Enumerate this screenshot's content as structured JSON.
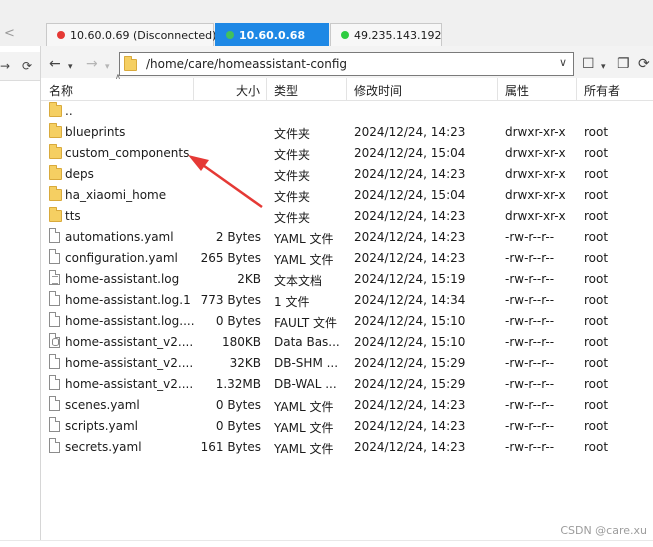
{
  "tabs": [
    {
      "label": "10.60.0.69 (Disconnected)",
      "dot_color": "#e53935",
      "active": false
    },
    {
      "label": "10.60.0.68",
      "dot_color": "#43c15b",
      "active": true
    },
    {
      "label": "49.235.143.192",
      "dot_color": "#2ecc40",
      "active": false
    }
  ],
  "toolbar": {
    "path": "/home/care/homeassistant-config"
  },
  "columns": {
    "name": "名称",
    "size": "大小",
    "type": "类型",
    "modified": "修改时间",
    "attributes": "属性",
    "owner": "所有者"
  },
  "files": [
    {
      "name": "..",
      "size": "",
      "type": "",
      "modified": "",
      "perm": "",
      "owner": "",
      "kind": "folder"
    },
    {
      "name": "blueprints",
      "size": "",
      "type": "文件夹",
      "modified": "2024/12/24, 14:23",
      "perm": "drwxr-xr-x",
      "owner": "root",
      "kind": "folder"
    },
    {
      "name": "custom_components",
      "size": "",
      "type": "文件夹",
      "modified": "2024/12/24, 15:04",
      "perm": "drwxr-xr-x",
      "owner": "root",
      "kind": "folder"
    },
    {
      "name": "deps",
      "size": "",
      "type": "文件夹",
      "modified": "2024/12/24, 14:23",
      "perm": "drwxr-xr-x",
      "owner": "root",
      "kind": "folder"
    },
    {
      "name": "ha_xiaomi_home",
      "size": "",
      "type": "文件夹",
      "modified": "2024/12/24, 15:04",
      "perm": "drwxr-xr-x",
      "owner": "root",
      "kind": "folder"
    },
    {
      "name": "tts",
      "size": "",
      "type": "文件夹",
      "modified": "2024/12/24, 14:23",
      "perm": "drwxr-xr-x",
      "owner": "root",
      "kind": "folder"
    },
    {
      "name": "automations.yaml",
      "size": "2 Bytes",
      "type": "YAML 文件",
      "modified": "2024/12/24, 14:23",
      "perm": "-rw-r--r--",
      "owner": "root",
      "kind": "file"
    },
    {
      "name": "configuration.yaml",
      "size": "265 Bytes",
      "type": "YAML 文件",
      "modified": "2024/12/24, 14:23",
      "perm": "-rw-r--r--",
      "owner": "root",
      "kind": "file"
    },
    {
      "name": "home-assistant.log",
      "size": "2KB",
      "type": "文本文档",
      "modified": "2024/12/24, 15:19",
      "perm": "-rw-r--r--",
      "owner": "root",
      "kind": "text"
    },
    {
      "name": "home-assistant.log.1",
      "size": "773 Bytes",
      "type": "1 文件",
      "modified": "2024/12/24, 14:34",
      "perm": "-rw-r--r--",
      "owner": "root",
      "kind": "file"
    },
    {
      "name": "home-assistant.log....",
      "size": "0 Bytes",
      "type": "FAULT 文件",
      "modified": "2024/12/24, 15:10",
      "perm": "-rw-r--r--",
      "owner": "root",
      "kind": "file"
    },
    {
      "name": "home-assistant_v2....",
      "size": "180KB",
      "type": "Data Bas...",
      "modified": "2024/12/24, 15:10",
      "perm": "-rw-r--r--",
      "owner": "root",
      "kind": "db"
    },
    {
      "name": "home-assistant_v2....",
      "size": "32KB",
      "type": "DB-SHM ...",
      "modified": "2024/12/24, 15:29",
      "perm": "-rw-r--r--",
      "owner": "root",
      "kind": "file"
    },
    {
      "name": "home-assistant_v2....",
      "size": "1.32MB",
      "type": "DB-WAL ...",
      "modified": "2024/12/24, 15:29",
      "perm": "-rw-r--r--",
      "owner": "root",
      "kind": "file"
    },
    {
      "name": "scenes.yaml",
      "size": "0 Bytes",
      "type": "YAML 文件",
      "modified": "2024/12/24, 14:23",
      "perm": "-rw-r--r--",
      "owner": "root",
      "kind": "file"
    },
    {
      "name": "scripts.yaml",
      "size": "0 Bytes",
      "type": "YAML 文件",
      "modified": "2024/12/24, 14:23",
      "perm": "-rw-r--r--",
      "owner": "root",
      "kind": "file"
    },
    {
      "name": "secrets.yaml",
      "size": "161 Bytes",
      "type": "YAML 文件",
      "modified": "2024/12/24, 14:23",
      "perm": "-rw-r--r--",
      "owner": "root",
      "kind": "file"
    }
  ],
  "annotation": {
    "color": "#e53935"
  },
  "watermark": "CSDN @care.xu"
}
